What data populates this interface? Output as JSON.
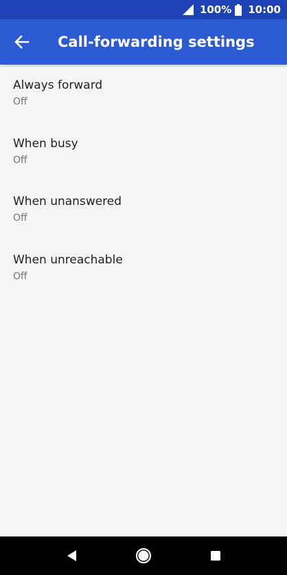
{
  "status_bar": {
    "battery_percent": "100%",
    "time": "10:00",
    "icons": [
      "signal-icon",
      "battery-icon"
    ]
  },
  "app_bar": {
    "title": "Call-forwarding settings",
    "back_icon": "back-arrow-icon"
  },
  "settings": [
    {
      "title": "Always forward",
      "value": "Off"
    },
    {
      "title": "When busy",
      "value": "Off"
    },
    {
      "title": "When unanswered",
      "value": "Off"
    },
    {
      "title": "When unreachable",
      "value": "Off"
    }
  ],
  "nav_bar": {
    "icons": [
      "nav-back-icon",
      "nav-home-icon",
      "nav-recents-icon"
    ]
  },
  "colors": {
    "status_bar": "#1d42b5",
    "app_bar": "#2b5ad1",
    "background": "#f5f5f5",
    "nav_bar": "#000000"
  }
}
